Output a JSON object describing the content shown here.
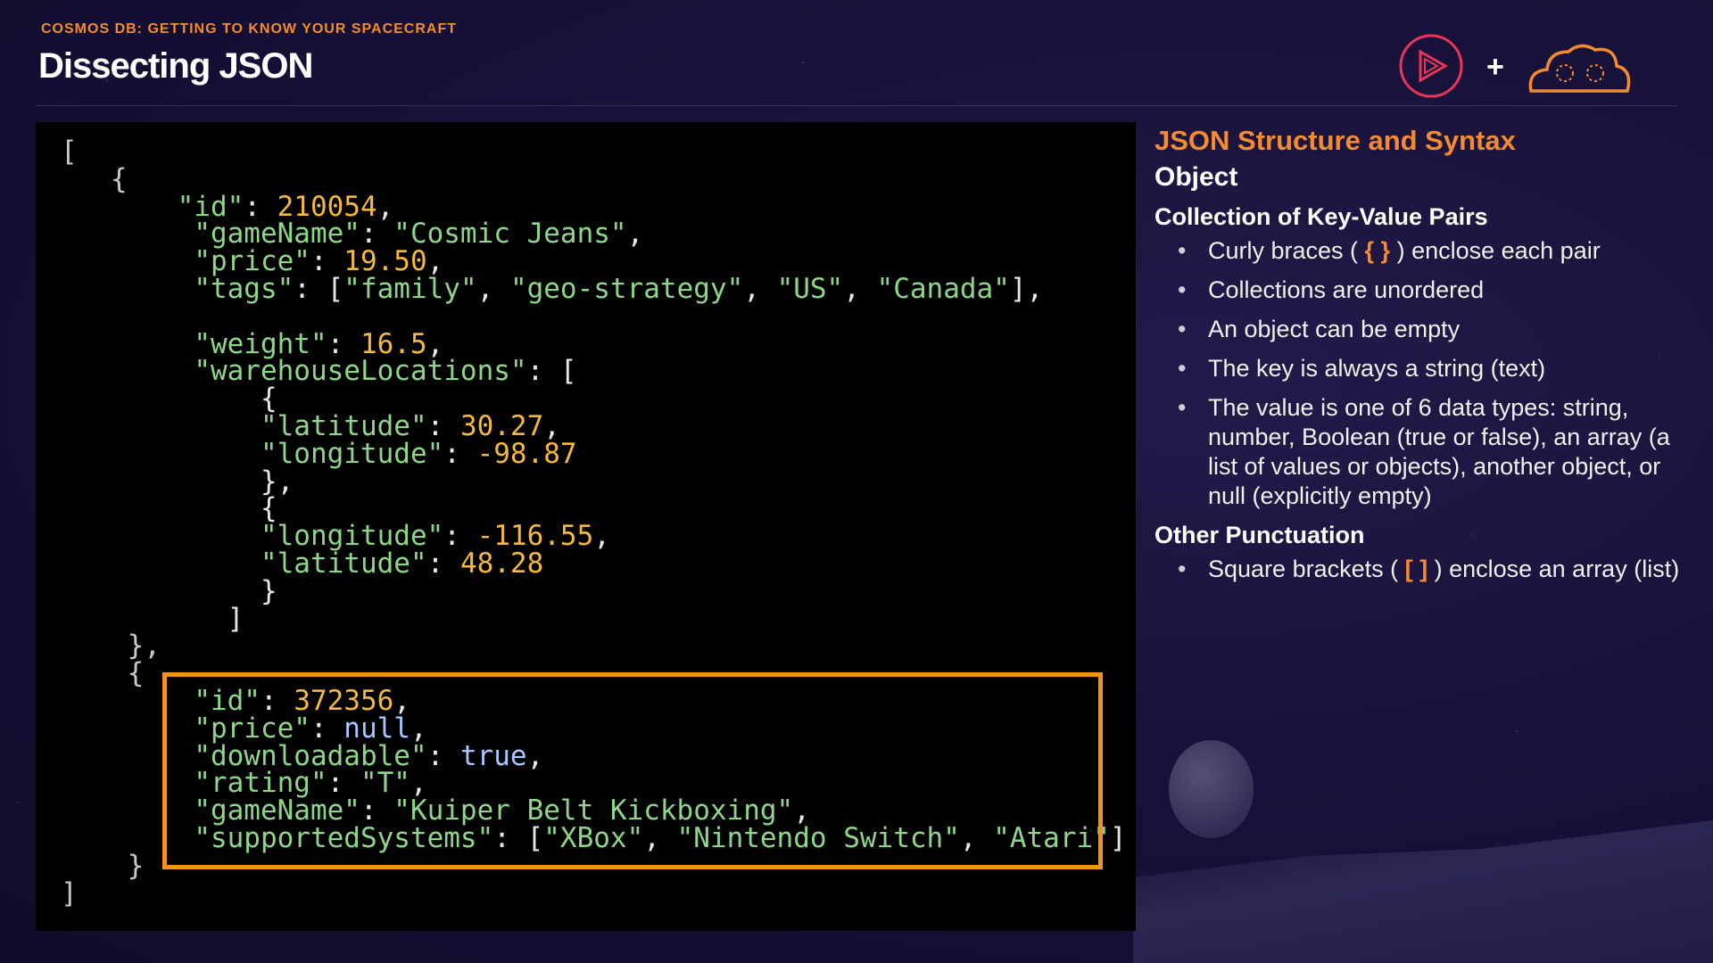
{
  "header": {
    "eyebrow": "COSMOS DB: GETTING TO KNOW YOUR SPACECRAFT",
    "title": "Dissecting JSON",
    "plus": "+"
  },
  "colors": {
    "accent": "#f58a2e",
    "highlight_border": "#f5921e",
    "code_bg": "#000000"
  },
  "code": {
    "open_array": "[",
    "obj1": {
      "open": "{",
      "id_key": "\"id\"",
      "id_val": "210054",
      "gameName_key": "\"gameName\"",
      "gameName_val": "\"Cosmic Jeans\"",
      "price_key": "\"price\"",
      "price_val": "19.50",
      "tags_key": "\"tags\"",
      "tags": [
        "\"family\"",
        "\"geo-strategy\"",
        "\"US\"",
        "\"Canada\""
      ],
      "weight_key": "\"weight\"",
      "weight_val": "16.5",
      "wh_key": "\"warehouseLocations\"",
      "loc1": {
        "lat_key": "\"latitude\"",
        "lat_val": "30.27",
        "lon_key": "\"longitude\"",
        "lon_val": "-98.87"
      },
      "loc2": {
        "lon_key": "\"longitude\"",
        "lon_val": "-116.55",
        "lat_key": "\"latitude\"",
        "lat_val": "48.28"
      },
      "close": "},"
    },
    "obj2": {
      "open": "{",
      "id_key": "\"id\"",
      "id_val": "372356",
      "price_key": "\"price\"",
      "price_val": "null",
      "downloadable_key": "\"downloadable\"",
      "downloadable_val": "true",
      "rating_key": "\"rating\"",
      "rating_val": "\"T\"",
      "gameName_key": "\"gameName\"",
      "gameName_val": "\"Kuiper Belt Kickboxing\"",
      "systems_key": "\"supportedSystems\"",
      "systems": [
        "\"XBox\"",
        "\"Nintendo Switch\"",
        "\"Atari\""
      ],
      "close": "}"
    },
    "close_array": "]"
  },
  "side": {
    "heading": "JSON Structure and Syntax",
    "object_title": "Object",
    "collection_title": "Collection of Key-Value Pairs",
    "bullets": [
      {
        "pre": "Curly braces ( ",
        "sym": "{ }",
        "post": " ) enclose each pair"
      },
      {
        "text": "Collections are unordered"
      },
      {
        "text": "An object can be empty"
      },
      {
        "text": "The key is always a string (text)"
      },
      {
        "text": "The value is one of 6 data types: string, number, Boolean (true or false), an array (a list of values or objects), another object, or null (explicitly empty)"
      }
    ],
    "punct_title": "Other Punctuation",
    "punct_bullet": {
      "pre": "Square brackets ( ",
      "sym": "[ ]",
      "post": " ) enclose an array (list)"
    }
  }
}
